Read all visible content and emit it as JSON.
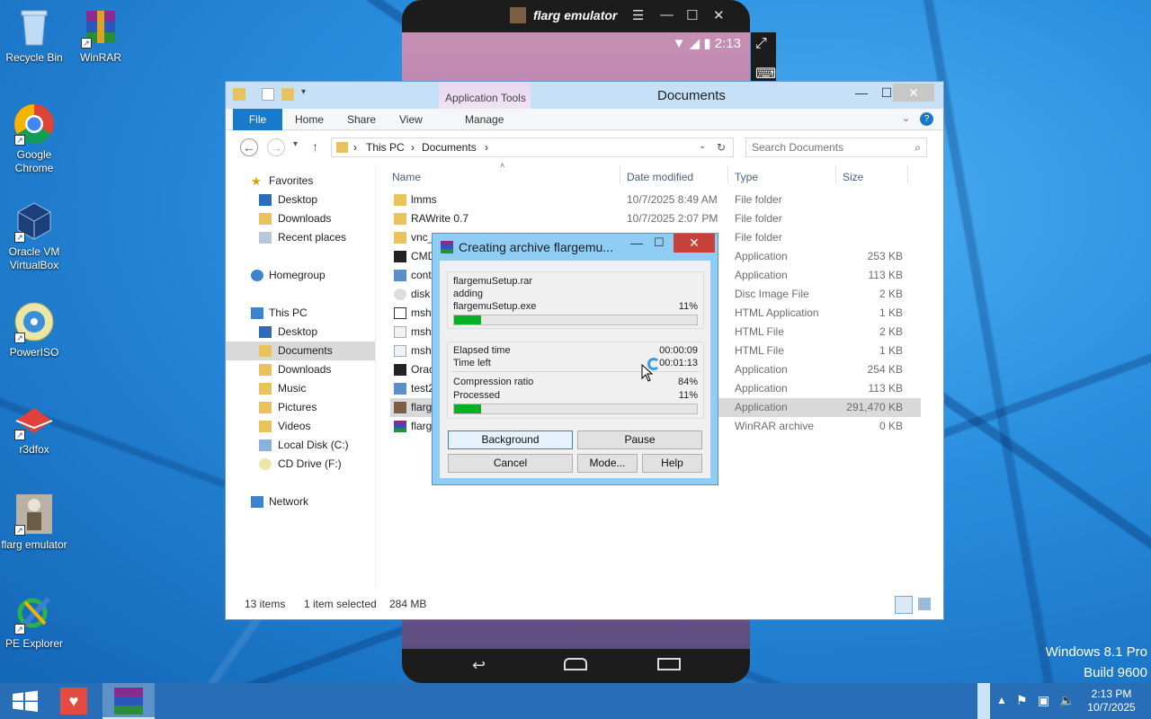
{
  "desktop": {
    "icons": [
      {
        "label": "Recycle Bin"
      },
      {
        "label": "WinRAR"
      },
      {
        "label": "Google Chrome"
      },
      {
        "label": "Oracle VM VirtualBox"
      },
      {
        "label": "PowerISO"
      },
      {
        "label": "r3dfox"
      },
      {
        "label": "flarg emulator"
      },
      {
        "label": "PE Explorer"
      }
    ],
    "watermark": {
      "line1": "Windows 8.1 Pro",
      "line2": "Build 9600"
    }
  },
  "emulator": {
    "title": "flarg emulator",
    "clock": "2:13"
  },
  "explorer": {
    "title": "Documents",
    "context_tab": "Application Tools",
    "tabs": {
      "file": "File",
      "home": "Home",
      "share": "Share",
      "view": "View",
      "manage": "Manage"
    },
    "breadcrumb": {
      "root": "This PC",
      "current": "Documents"
    },
    "search_placeholder": "Search Documents",
    "nav": {
      "favorites": "Favorites",
      "fav_desktop": "Desktop",
      "fav_downloads": "Downloads",
      "fav_recent": "Recent places",
      "homegroup": "Homegroup",
      "thispc": "This PC",
      "pc_desktop": "Desktop",
      "pc_documents": "Documents",
      "pc_downloads": "Downloads",
      "pc_music": "Music",
      "pc_pictures": "Pictures",
      "pc_videos": "Videos",
      "pc_localdisk": "Local Disk (C:)",
      "pc_cddrive": "CD Drive (F:)",
      "network": "Network"
    },
    "columns": {
      "name": "Name",
      "date": "Date modified",
      "type": "Type",
      "size": "Size"
    },
    "files": [
      {
        "name": "lmms",
        "date": "10/7/2025 8:49 AM",
        "type": "File folder",
        "size": ""
      },
      {
        "name": "RAWrite 0.7",
        "date": "10/7/2025 2:07 PM",
        "type": "File folder",
        "size": ""
      },
      {
        "name": "vnc_",
        "date": "",
        "type": "File folder",
        "size": ""
      },
      {
        "name": "CMD",
        "date": "",
        "type": "Application",
        "size": "253 KB"
      },
      {
        "name": "cont",
        "date": "",
        "type": "Application",
        "size": "113 KB"
      },
      {
        "name": "disk",
        "date": "",
        "type": "Disc Image File",
        "size": "2 KB"
      },
      {
        "name": "msht",
        "date": "",
        "type": "HTML Application",
        "size": "1 KB"
      },
      {
        "name": "msht",
        "date": "",
        "type": "HTML File",
        "size": "2 KB"
      },
      {
        "name": "msht",
        "date": "",
        "type": "HTML File",
        "size": "1 KB"
      },
      {
        "name": "Orac",
        "date": "",
        "type": "Application",
        "size": "254 KB"
      },
      {
        "name": "test2",
        "date": "",
        "type": "Application",
        "size": "113 KB"
      },
      {
        "name": "flarg",
        "date": "",
        "type": "Application",
        "size": "291,470 KB"
      },
      {
        "name": "flarg",
        "date": "",
        "type": "WinRAR archive",
        "size": "0 KB"
      }
    ],
    "status": {
      "items": "13 items",
      "selected": "1 item selected",
      "size": "284 MB"
    }
  },
  "rar_dialog": {
    "title": "Creating archive flargemu...",
    "archive": "flargemuSetup.rar",
    "action": "adding",
    "file": "flargemuSetup.exe",
    "file_percent": "11%",
    "file_progress": 0.11,
    "elapsed_label": "Elapsed time",
    "elapsed": "00:00:09",
    "left_label": "Time left",
    "left": "00:01:13",
    "ratio_label": "Compression ratio",
    "ratio": "84%",
    "processed_label": "Processed",
    "processed": "11%",
    "processed_progress": 0.11,
    "buttons": {
      "background": "Background",
      "pause": "Pause",
      "cancel": "Cancel",
      "mode": "Mode...",
      "help": "Help"
    }
  },
  "taskbar": {
    "time": "2:13 PM",
    "date": "10/7/2025"
  }
}
